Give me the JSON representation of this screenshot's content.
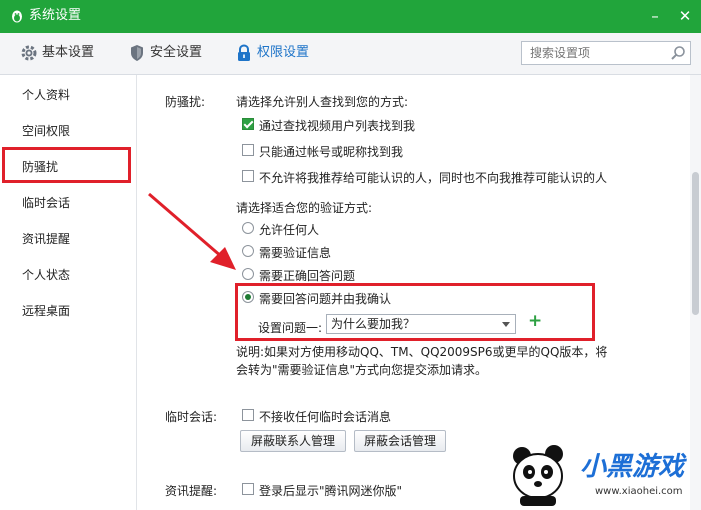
{
  "window": {
    "title": "系统设置",
    "minimize": "–",
    "close": "✕"
  },
  "toolbar": {
    "tabs": [
      {
        "label": "基本设置",
        "icon": "gear-icon"
      },
      {
        "label": "安全设置",
        "icon": "shield-icon"
      },
      {
        "label": "权限设置",
        "icon": "lock-icon",
        "active": true
      }
    ],
    "search_placeholder": "搜索设置项"
  },
  "sidebar": {
    "items": [
      {
        "label": "个人资料"
      },
      {
        "label": "空间权限"
      },
      {
        "label": "防骚扰",
        "selected": true
      },
      {
        "label": "临时会话"
      },
      {
        "label": "资讯提醒"
      },
      {
        "label": "个人状态"
      },
      {
        "label": "远程桌面"
      }
    ]
  },
  "anti_harass": {
    "section_label": "防骚扰:",
    "find_prompt": "请选择允许别人查找到您的方式:",
    "find_options": [
      {
        "label": "通过查找视频用户列表找到我",
        "checked": true
      },
      {
        "label": "只能通过帐号或昵称找到我",
        "checked": false
      },
      {
        "label": "不允许将我推荐给可能认识的人，同时也不向我推荐可能认识的人",
        "checked": false
      }
    ],
    "verify_prompt": "请选择适合您的验证方式:",
    "verify_options": [
      {
        "label": "允许任何人",
        "checked": false
      },
      {
        "label": "需要验证信息",
        "checked": false
      },
      {
        "label": "需要正确回答问题",
        "checked": false
      },
      {
        "label": "需要回答问题并由我确认",
        "checked": true
      }
    ],
    "question_label": "设置问题一:",
    "question_value": "为什么要加我？",
    "add_symbol": "+",
    "note_line1": "说明:如果对方使用移动QQ、TM、QQ2009SP6或更早的QQ版本，将",
    "note_line2": "会转为\"需要验证信息\"方式向您提交添加请求。"
  },
  "temp_session": {
    "section_label": "临时会话:",
    "option": {
      "label": "不接收任何临时会话消息",
      "checked": false
    },
    "buttons": [
      "屏蔽联系人管理",
      "屏蔽会话管理"
    ]
  },
  "news": {
    "section_label": "资讯提醒:",
    "option": {
      "label": "登录后显示\"腾讯网迷你版\"",
      "checked": false
    }
  },
  "watermark": {
    "brand": "小黑游戏",
    "url": "www.xiaohei.com"
  },
  "colors": {
    "titlebar": "#21a53b",
    "highlight": "#e0202a",
    "active_tab": "#1e74c8"
  }
}
